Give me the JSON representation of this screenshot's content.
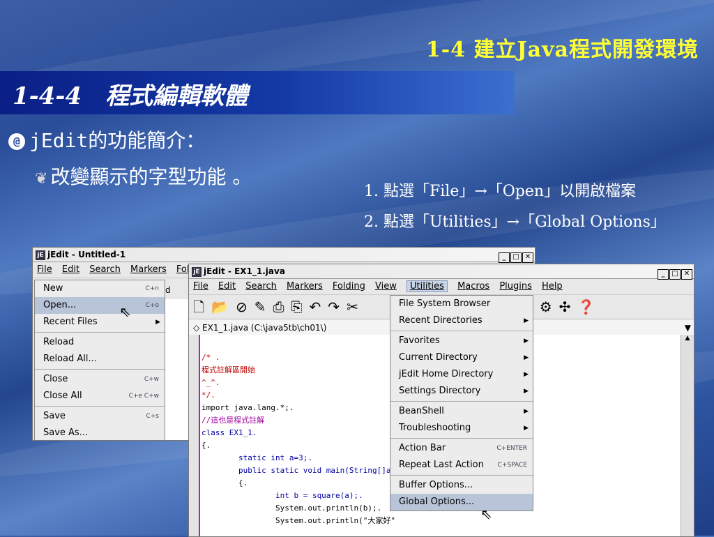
{
  "slide": {
    "title": "1-4 建立Java程式開發環境",
    "section": "1-4-4　程式編輯軟體",
    "bullet1": "jEdit的功能簡介：",
    "bullet2": "改變顯示的字型功能 。",
    "step1": "1. 點選「File」→「Open」以開啟檔案",
    "step2": "2. 點選「Utilities」→「Global Options」"
  },
  "win1": {
    "title": "jEdit - Untitled-1",
    "menus": [
      "File",
      "Edit",
      "Search",
      "Markers",
      "Foldi"
    ],
    "file_menu": [
      {
        "label": "New",
        "shortcut": "C+n"
      },
      {
        "label": "Open...",
        "shortcut": "C+o"
      },
      {
        "label": "Recent Files",
        "shortcut": "▶"
      },
      {
        "label": "Reload",
        "shortcut": ""
      },
      {
        "label": "Reload All...",
        "shortcut": ""
      },
      {
        "label": "Close",
        "shortcut": "C+w"
      },
      {
        "label": "Close All",
        "shortcut": "C+e C+w"
      },
      {
        "label": "Save",
        "shortcut": "C+s"
      },
      {
        "label": "Save As...",
        "shortcut": ""
      }
    ],
    "toolbar_frag": "d Setti"
  },
  "win2": {
    "title": "jEdit - EX1_1.java",
    "menus": [
      "File",
      "Edit",
      "Search",
      "Markers",
      "Folding",
      "View",
      "Utilities",
      "Macros",
      "Plugins",
      "Help"
    ],
    "buffer": "◇ EX1_1.java (C:\\java5tb\\ch01\\)",
    "utilities_menu": [
      {
        "label": "File System Browser",
        "shortcut": ""
      },
      {
        "label": "Recent Directories",
        "shortcut": "▶"
      },
      {
        "label": "Favorites",
        "shortcut": "▶"
      },
      {
        "label": "Current Directory",
        "shortcut": "▶"
      },
      {
        "label": "jEdit Home Directory",
        "shortcut": "▶"
      },
      {
        "label": "Settings Directory",
        "shortcut": "▶"
      },
      {
        "label": "BeanShell",
        "shortcut": "▶"
      },
      {
        "label": "Troubleshooting",
        "shortcut": "▶"
      },
      {
        "label": "Action Bar",
        "shortcut": "C+ENTER"
      },
      {
        "label": "Repeat Last Action",
        "shortcut": "C+SPACE"
      },
      {
        "label": "Buffer Options...",
        "shortcut": ""
      },
      {
        "label": "Global Options...",
        "shortcut": ""
      }
    ],
    "code": [
      "/* .",
      "程式註解區開始",
      "^_^.",
      "*/.",
      "import java.lang.*;.",
      "//這也是程式註解",
      "class EX1_1.",
      "{.",
      "        static int a=3;.",
      "        public static void main(String[]arg",
      "        {.",
      "                int b = square(a);.",
      "                System.out.println(b);.",
      "                System.out.println(\"大家好\""
    ]
  }
}
